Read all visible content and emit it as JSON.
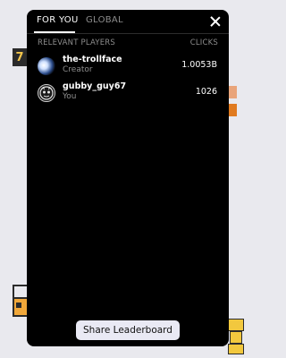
{
  "background": {
    "left_box_text": "7"
  },
  "tabs": [
    {
      "label": "FOR YOU",
      "active": true
    },
    {
      "label": "GLOBAL",
      "active": false
    }
  ],
  "list": {
    "header_left": "RELEVANT PLAYERS",
    "header_right": "CLICKS",
    "players": [
      {
        "name": "the-trollface",
        "role": "Creator",
        "clicks": "1.0053B",
        "avatar": "moon-avatar"
      },
      {
        "name": "gubby_guy67",
        "role": "You",
        "clicks": "1026",
        "avatar": "cat-face-avatar"
      }
    ]
  },
  "share_button": {
    "label": "Share Leaderboard"
  },
  "colors": {
    "modal_bg": "#000000",
    "muted_text": "#8d8d8d",
    "button_bg": "#e9e9f4",
    "accent_orange": "#e07a1f"
  }
}
